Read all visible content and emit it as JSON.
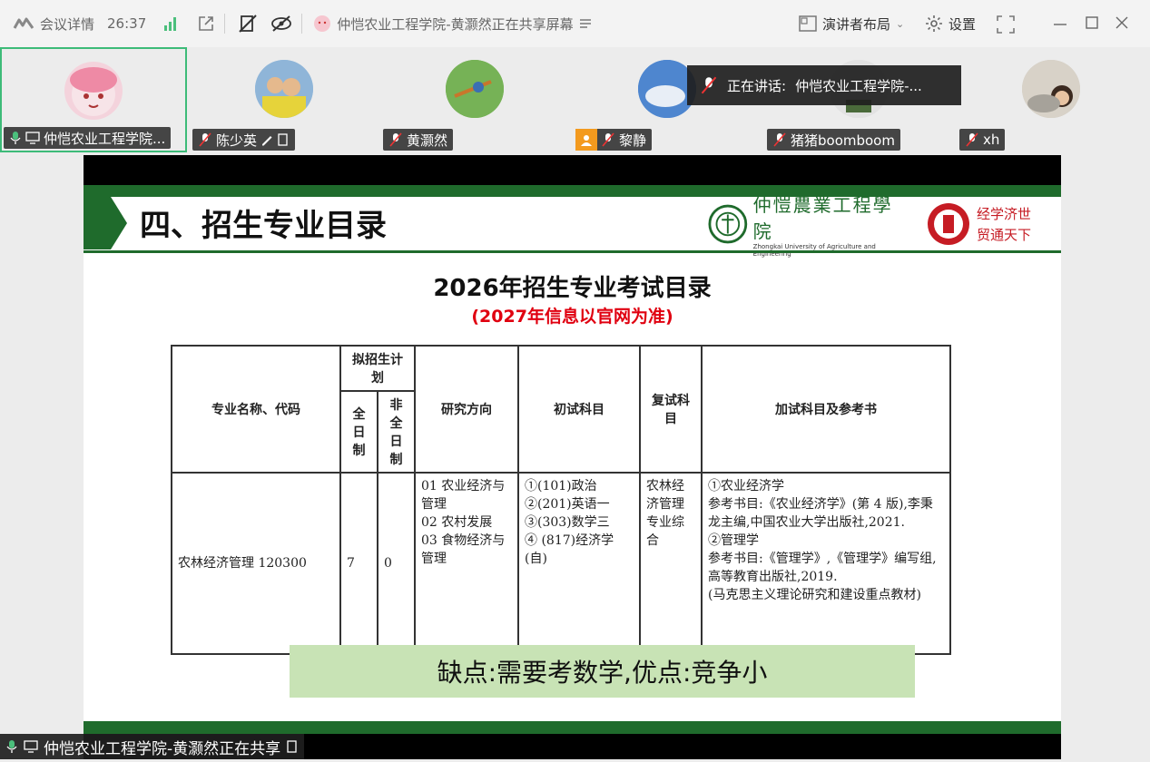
{
  "topbar": {
    "meeting_details": "会议详情",
    "timer": "26:37",
    "sharing_title": "仲恺农业工程学院-黄灏然正在共享屏幕",
    "layout": "演讲者布局",
    "settings": "设置"
  },
  "participants": [
    {
      "name": "仲恺农业工程学院..."
    },
    {
      "name": "陈少英"
    },
    {
      "name": "黄灏然"
    },
    {
      "name": "黎静"
    },
    {
      "name": "猪猪boomboom"
    },
    {
      "name": "xh"
    }
  ],
  "speaking": {
    "label": "正在讲话:",
    "name": "仲恺农业工程学院-..."
  },
  "slide": {
    "section_title": "四、招生专业目录",
    "logo_text": "仲愷農業工程學院",
    "logo_sub": "Zhongkai University of Agriculture and Engineering",
    "motto_line1": "经学济世",
    "motto_line2": "贸通天下",
    "heading": "2026年招生专业考试目录",
    "note": "(2027年信息以官网为准)",
    "table": {
      "h_major": "专业名称、代码",
      "h_plan": "拟招生计划",
      "h_full": "全日制",
      "h_part": "非全日制",
      "h_direction": "研究方向",
      "h_initial": "初试科目",
      "h_retest": "复试科目",
      "h_extra": "加试科目及参考书",
      "major": "农林经济管理 120300",
      "full": "7",
      "part": "0",
      "direction": [
        "01 农业经济与管理",
        "02 农村发展",
        "03 食物经济与管理"
      ],
      "initial": [
        "①(101)政治",
        "②(201)英语一",
        "③(303)数学三",
        "④ (817)经济学(自)"
      ],
      "retest": "农林经济管理专业综合",
      "extra": [
        "①农业经济学",
        "参考书目:《农业经济学》(第 4 版),李秉龙主编,中国农业大学出版社,2021.",
        "②管理学",
        "参考书目:《管理学》,《管理学》编写组,高等教育出版社,2019.",
        "(马克思主义理论研究和建设重点教材)"
      ]
    },
    "summary": "缺点:需要考数学,优点:竞争小"
  },
  "bottom_tag": "仲恺农业工程学院-黄灏然正在共享"
}
